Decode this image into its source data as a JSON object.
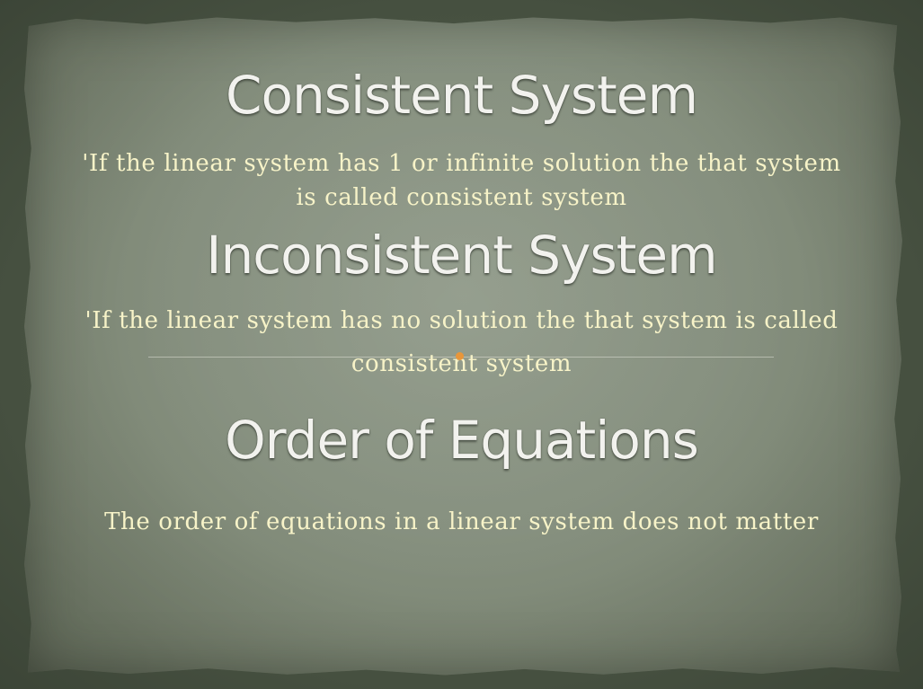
{
  "slide": {
    "heading_1": "Consistent System",
    "text_1_line_1": "'If the linear system has 1 or infinite solution the that system",
    "text_1_line_2": "is called consistent system",
    "heading_2": "Inconsistent System",
    "text_2_line_1": "'If the linear system has no solution the that system is called",
    "text_2_line_2": "consistent system",
    "heading_3": "Order of Equations",
    "text_3": "The order of equations in a linear system does not matter"
  },
  "colors": {
    "background": "#4a5443",
    "paper": "#858f7e",
    "heading_text": "#f2f2ee",
    "body_text": "#f7f3c8",
    "accent_dot": "#e8963a"
  }
}
